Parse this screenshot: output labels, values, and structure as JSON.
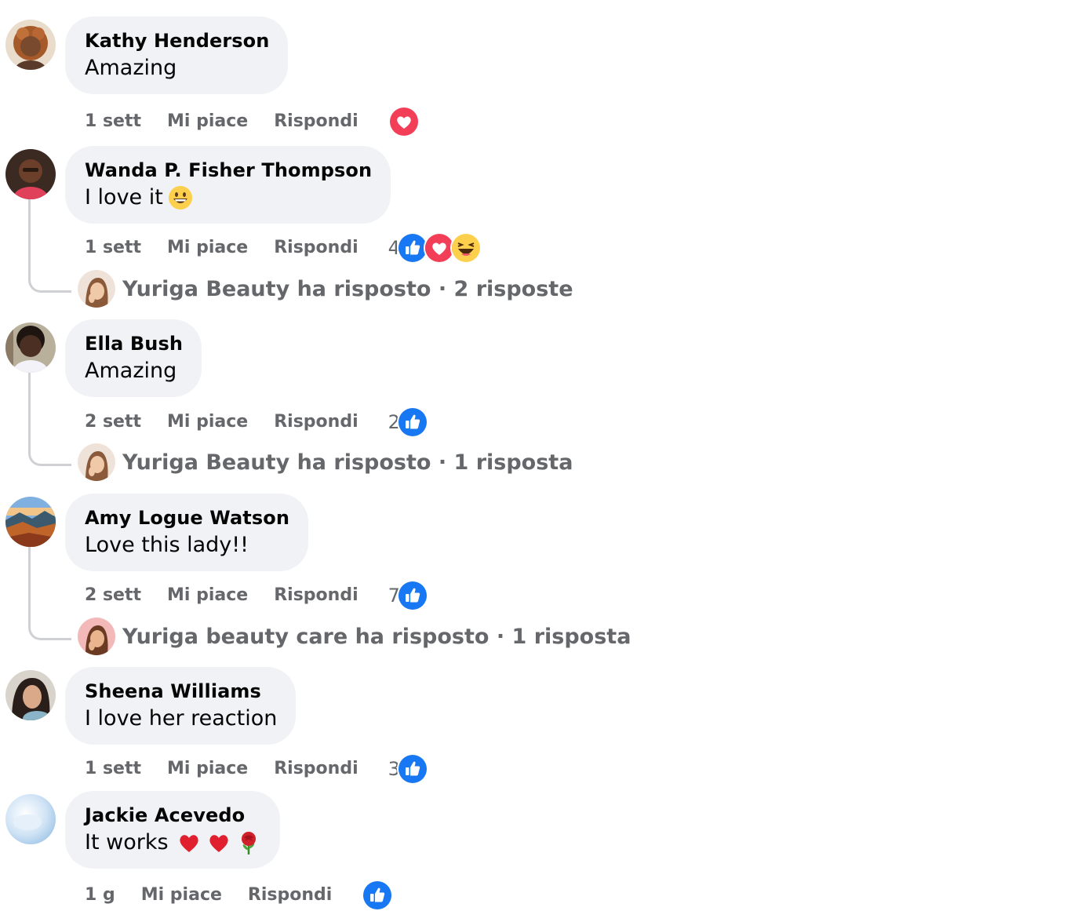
{
  "comments": [
    {
      "author": "Kathy Henderson",
      "text": "Amazing",
      "time": "1 sett",
      "like_label": "Mi piace",
      "reply_label": "Rispondi",
      "reaction_count": "",
      "reactions": [
        "love-icon"
      ]
    },
    {
      "author": "Wanda P. Fisher Thompson",
      "text": "I love it",
      "text_emoji": [
        "grinning-face-icon"
      ],
      "time": "1 sett",
      "like_label": "Mi piace",
      "reply_label": "Rispondi",
      "reaction_count": "4",
      "reactions": [
        "like-icon",
        "love-icon",
        "haha-icon"
      ],
      "replies": {
        "summary": "Yuriga Beauty ha risposto · 2 risposte"
      }
    },
    {
      "author": "Ella Bush",
      "text": "Amazing",
      "time": "2 sett",
      "like_label": "Mi piace",
      "reply_label": "Rispondi",
      "reaction_count": "2",
      "reactions": [
        "like-icon"
      ],
      "replies": {
        "summary": "Yuriga Beauty ha risposto · 1 risposta"
      }
    },
    {
      "author": "Amy Logue Watson",
      "text": "Love this lady!!",
      "time": "2 sett",
      "like_label": "Mi piace",
      "reply_label": "Rispondi",
      "reaction_count": "7",
      "reactions": [
        "like-icon"
      ],
      "replies": {
        "summary": "Yuriga beauty care ha risposto · 1 risposta"
      }
    },
    {
      "author": "Sheena Williams",
      "text": "I love her reaction",
      "time": "1 sett",
      "like_label": "Mi piace",
      "reply_label": "Rispondi",
      "reaction_count": "3",
      "reactions": [
        "like-icon"
      ]
    },
    {
      "author": "Jackie Acevedo",
      "text": "It works",
      "text_emoji": [
        "red-heart-icon",
        "red-heart-icon",
        "rose-icon"
      ],
      "time": "1 g",
      "like_label": "Mi piace",
      "reply_label": "Rispondi",
      "reaction_count": "",
      "reactions": [
        "like-icon"
      ]
    }
  ],
  "colors": {
    "bubble_bg": "#f0f2f5",
    "meta_text": "#65676b",
    "like_blue": "#1877f2",
    "love_red": "#f33e58",
    "haha_yellow": "#fcd04d",
    "thread_line": "#ced0d4"
  }
}
